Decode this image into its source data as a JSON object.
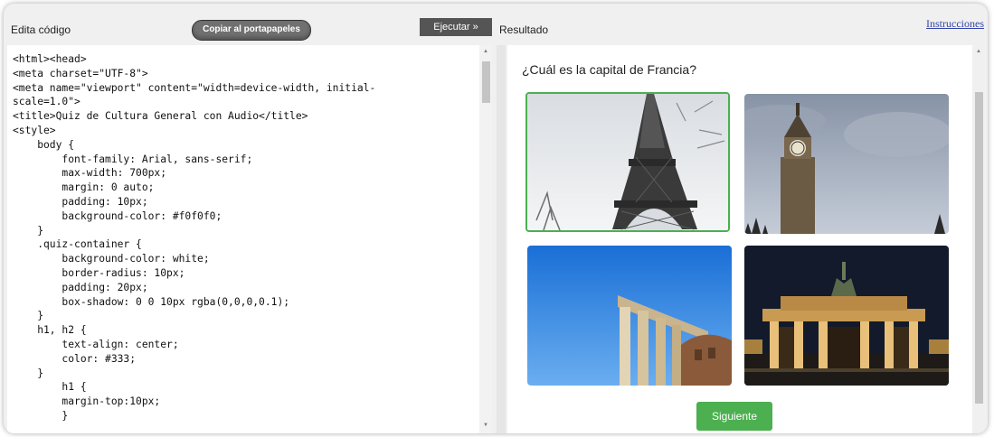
{
  "toolbar": {
    "edit_label": "Edita código",
    "copy_button": "Copiar al portapapeles",
    "run_button": "Ejecutar »",
    "result_label": "Resultado",
    "instructions_link": "Instrucciones"
  },
  "editor": {
    "code_lines": [
      "<html><head>",
      "<meta charset=\"UTF-8\">",
      "<meta name=\"viewport\" content=\"width=device-width, initial-",
      "scale=1.0\">",
      "<title>Quiz de Cultura General con Audio</title>",
      "<style>",
      "    body {",
      "        font-family: Arial, sans-serif;",
      "        max-width: 700px;",
      "        margin: 0 auto;",
      "        padding: 10px;",
      "        background-color: #f0f0f0;",
      "    }",
      "    .quiz-container {",
      "        background-color: white;",
      "        border-radius: 10px;",
      "        padding: 20px;",
      "        box-shadow: 0 0 10px rgba(0,0,0,0.1);",
      "    }",
      "    h1, h2 {",
      "        text-align: center;",
      "        color: #333;",
      "    }",
      "        h1 {",
      "        margin-top:10px;",
      "        }"
    ]
  },
  "quiz": {
    "question": "¿Cuál es la capital de Francia?",
    "options": [
      {
        "icon": "eiffel-tower-photo",
        "selected": true
      },
      {
        "icon": "big-ben-photo",
        "selected": false
      },
      {
        "icon": "roman-ruins-photo",
        "selected": false
      },
      {
        "icon": "brandenburg-gate-photo",
        "selected": false
      }
    ],
    "next_button": "Siguiente"
  },
  "colors": {
    "accent_green": "#4caf50",
    "run_button_bg": "#555555",
    "link": "#3344aa"
  }
}
